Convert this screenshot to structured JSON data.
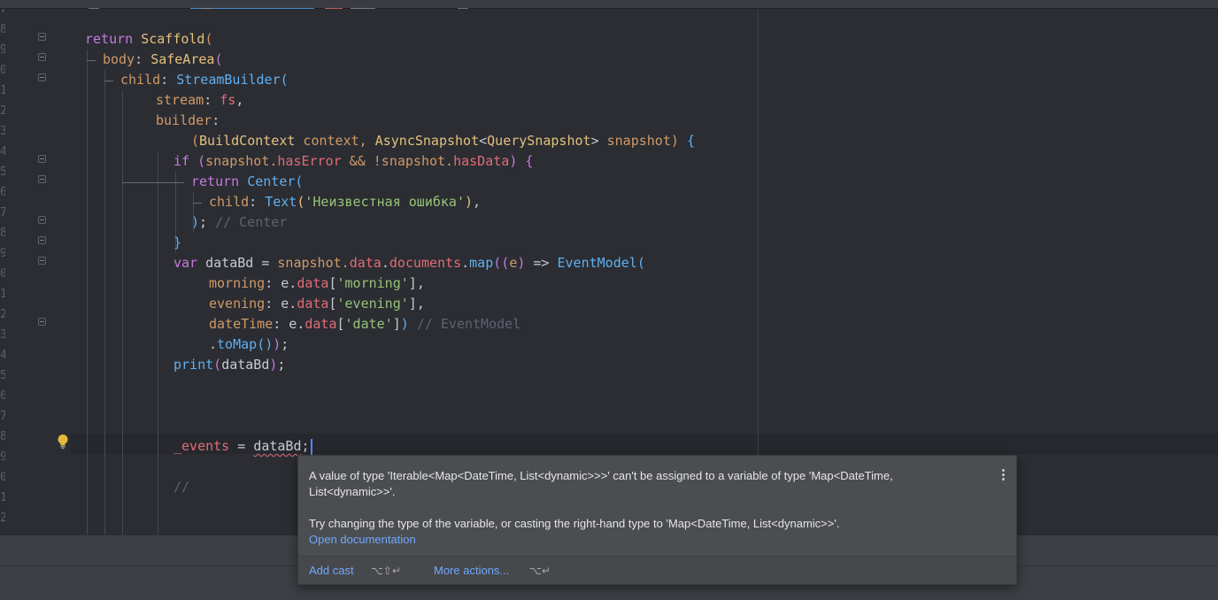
{
  "line_numbers": [
    "7",
    "8",
    "9",
    "0",
    "1",
    "2",
    "3",
    "4",
    "5",
    "6",
    "7",
    "8",
    "9",
    "0",
    "1",
    "2",
    "3",
    "4",
    "5",
    "6",
    "7",
    "8",
    "9",
    "0",
    "1",
    "2"
  ],
  "code": {
    "l1_return": "return ",
    "l1_scaffold": "Scaffold",
    "l1_paren": "(",
    "l2_body": "body",
    "l2_colon": ": ",
    "l2_safearea": "SafeArea",
    "l2_paren": "(",
    "l3_child": "child",
    "l3_colon": ": ",
    "l3_streambuilder": "StreamBuilder",
    "l3_paren": "(",
    "l4_stream": "stream",
    "l4_colon": ": ",
    "l4_fs": "fs",
    "l4_comma": ",",
    "l5_builder": "builder",
    "l5_colon": ":",
    "l6_paren_open": "(",
    "l6_buildcontext": "BuildContext",
    "l6_context": " context, ",
    "l6_asyncsnapshot": "AsyncSnapshot",
    "l6_lt": "<",
    "l6_querysnapshot": "QuerySnapshot",
    "l6_gt": "> ",
    "l6_snapshot": "snapshot",
    "l6_paren_close": ") ",
    "l6_brace": "{",
    "l7_if": "if ",
    "l7_paren": "(",
    "l7_snapshot": "snapshot.",
    "l7_haserror": "hasError",
    "l7_and": " && !snapshot.",
    "l7_hasdata": "hasData",
    "l7_close": ") ",
    "l7_brace": "{",
    "l8_return": "return ",
    "l8_center": "Center",
    "l8_paren": "(",
    "l9_child": "child",
    "l9_colon": ": ",
    "l9_text": "Text",
    "l9_popen": "(",
    "l9_string": "'Неизвестная ошибка'",
    "l9_pclose": ")",
    "l9_comma": ",",
    "l10_paren": ")",
    "l10_semi": "; ",
    "l10_comment": "// Center",
    "l11_brace": "}",
    "l12_var": "var ",
    "l12_databd": "dataBd = ",
    "l12_snapshot": "snapshot.",
    "l12_data": "data",
    "l12_dot1": ".",
    "l12_documents": "documents",
    "l12_dot2": ".",
    "l12_map": "map",
    "l12_p1": "(",
    "l12_p2": "(",
    "l12_e": "e",
    "l12_p3": ")",
    "l12_arrow": " => ",
    "l12_eventmodel": "EventModel",
    "l12_p4": "(",
    "l13_morning": "morning",
    "l13_colon": ": e.",
    "l13_data": "data",
    "l13_bopen": "[",
    "l13_str": "'morning'",
    "l13_bclose": "]",
    "l13_comma": ",",
    "l14_evening": "evening",
    "l14_colon": ": e.",
    "l14_data": "data",
    "l14_bopen": "[",
    "l14_str": "'evening'",
    "l14_bclose": "]",
    "l14_comma": ",",
    "l15_datetime": "dateTime",
    "l15_colon": ": e.",
    "l15_data": "data",
    "l15_bopen": "[",
    "l15_str": "'date'",
    "l15_bclose": "]",
    "l15_pclose": ") ",
    "l15_comment": "// EventModel",
    "l16_dot": ".",
    "l16_tomap": "toMap",
    "l16_parens": "()",
    "l16_close": ")",
    "l16_semi": ";",
    "l17_print": "print",
    "l17_popen": "(",
    "l17_arg": "dataBd",
    "l17_pclose": ")",
    "l17_semi": ";",
    "l21_events": "_events",
    "l21_eq": " = ",
    "l21_databd": "dataBd",
    "l21_semi": ";",
    "l23_comment": "//"
  },
  "popup": {
    "message": "A value of type 'Iterable<Map<DateTime, List<dynamic>>>' can't be assigned to a variable of type 'Map<DateTime, List<dynamic>>'.",
    "hint": "Try changing the type of the variable, or casting the right-hand type to 'Map<DateTime, List<dynamic>>'.",
    "doc_link": "Open documentation",
    "action_add_cast": "Add cast",
    "action_add_cast_shortcut": "⌥⇧↵",
    "action_more": "More actions...",
    "action_more_shortcut": "⌥↵"
  },
  "icons": {
    "intention_bulb": "lightbulb-icon",
    "popup_menu": "more-vertical-icon",
    "fold": "fold-marker-icon"
  },
  "colors": {
    "background": "#2b2d33",
    "keyword": "#c679dd",
    "class": "#e5c07b",
    "constructor": "#61afef",
    "property": "#e06c75",
    "parameter": "#d19a66",
    "string": "#98c379",
    "comment": "#5c6370",
    "link": "#6fa8ff",
    "error_underline": "#e06c75",
    "popup_background": "#4b4d50"
  }
}
